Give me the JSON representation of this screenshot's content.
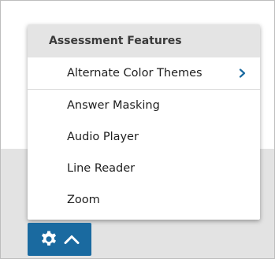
{
  "menu": {
    "header": "Assessment Features",
    "items": [
      {
        "label": "Alternate Color Themes",
        "has_submenu": true
      },
      {
        "label": "Answer Masking"
      },
      {
        "label": "Audio Player"
      },
      {
        "label": "Line Reader"
      },
      {
        "label": "Zoom"
      }
    ]
  },
  "toolbar": {
    "icons": [
      "gear-icon",
      "chevron-up-icon"
    ]
  },
  "colors": {
    "accent": "#1a6aa0",
    "header_bg": "#e4e4e4",
    "backdrop": "#e3e3e3"
  }
}
